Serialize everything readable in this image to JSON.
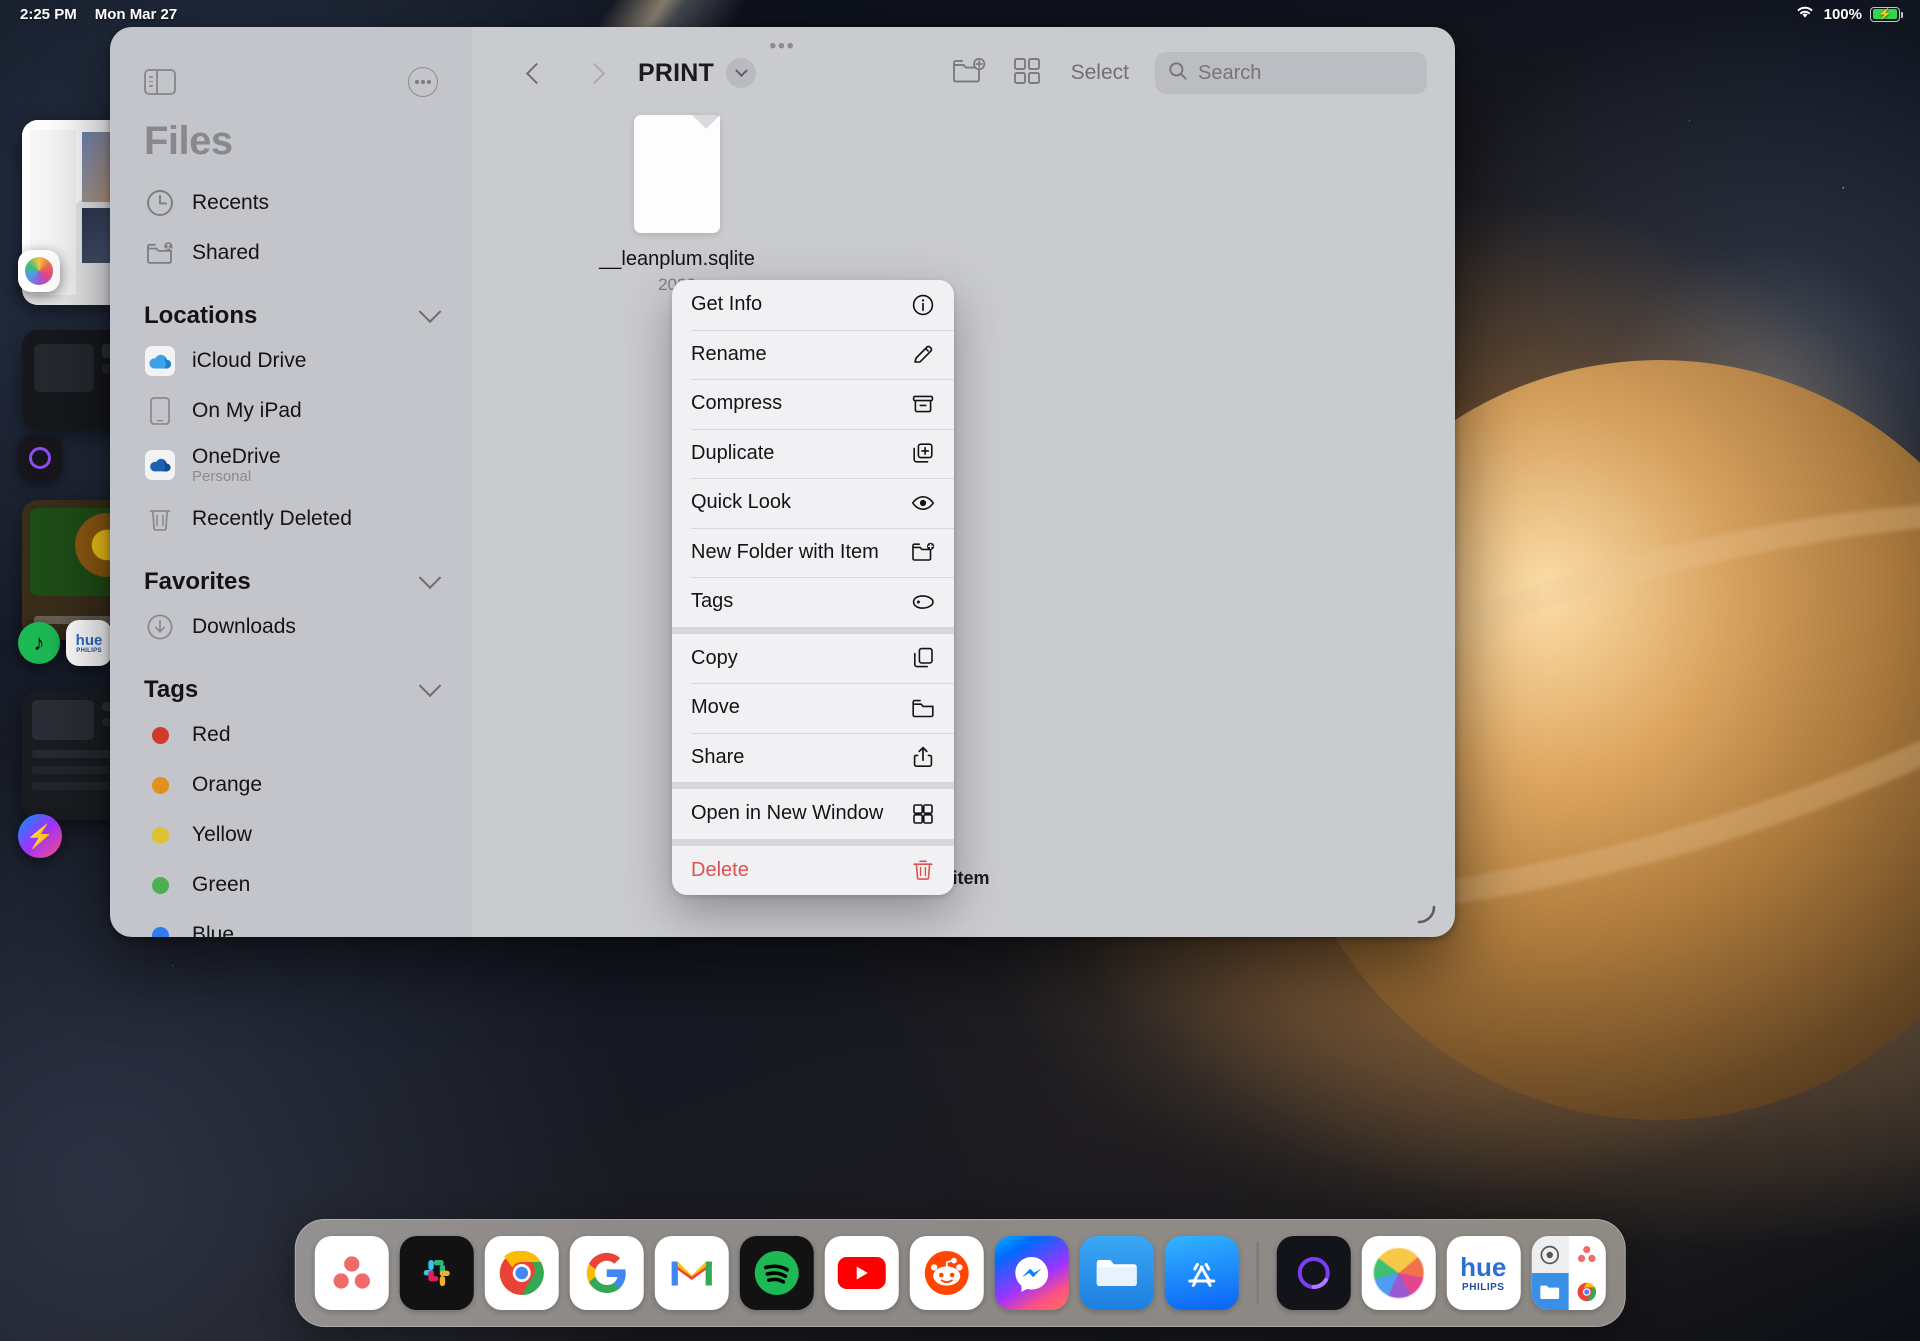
{
  "status_bar": {
    "time": "2:25 PM",
    "date": "Mon Mar 27",
    "wifi_icon": "wifi-icon",
    "battery_percent": "100%",
    "battery_state": "charging",
    "battery_color": "#32d74b"
  },
  "window": {
    "grabber": "•••",
    "sidebar": {
      "toggle_icon": "sidebar-toggle-icon",
      "more_icon": "ellipsis-circle-icon",
      "title": "Files",
      "top_items": [
        {
          "label": "Recents",
          "icon": "clock-icon"
        },
        {
          "label": "Shared",
          "icon": "shared-folder-icon"
        }
      ],
      "sections": [
        {
          "title": "Locations",
          "chevron": "chevron-down-icon",
          "items": [
            {
              "label": "iCloud Drive",
              "icon": "icloud-drive-icon",
              "sublabel": ""
            },
            {
              "label": "On My iPad",
              "icon": "ipad-icon",
              "sublabel": ""
            },
            {
              "label": "OneDrive",
              "icon": "onedrive-icon",
              "sublabel": "Personal"
            },
            {
              "label": "Recently Deleted",
              "icon": "trash-icon",
              "sublabel": ""
            }
          ]
        },
        {
          "title": "Favorites",
          "chevron": "chevron-down-icon",
          "items": [
            {
              "label": "Downloads",
              "icon": "download-circle-icon",
              "sublabel": ""
            }
          ]
        },
        {
          "title": "Tags",
          "chevron": "chevron-down-icon",
          "items": [
            {
              "label": "Red",
              "icon": "tag-dot-icon",
              "color": "#d0392b"
            },
            {
              "label": "Orange",
              "icon": "tag-dot-icon",
              "color": "#e0901f"
            },
            {
              "label": "Yellow",
              "icon": "tag-dot-icon",
              "color": "#ddc233"
            },
            {
              "label": "Green",
              "icon": "tag-dot-icon",
              "color": "#4caf50"
            },
            {
              "label": "Blue",
              "icon": "tag-dot-icon",
              "color": "#2f7dea"
            }
          ]
        }
      ]
    },
    "toolbar": {
      "back_icon": "chevron-left-icon",
      "forward_icon": "chevron-right-icon",
      "folder_title": "PRINT",
      "title_menu_icon": "chevron-down-circle-icon",
      "new_folder_icon": "new-folder-icon",
      "grid_view_icon": "grid-view-icon",
      "select_label": "Select",
      "search_icon": "search-icon",
      "search_placeholder": "Search",
      "search_value": ""
    },
    "files": [
      {
        "name": "__leanplum.sqlite",
        "meta": "2023",
        "icon": "document-icon"
      }
    ],
    "status": "1 item",
    "resize_icon": "resize-handle-icon"
  },
  "context_menu": {
    "groups": [
      [
        {
          "label": "Get Info",
          "icon": "info-circle-icon",
          "danger": false
        },
        {
          "label": "Rename",
          "icon": "pencil-icon",
          "danger": false
        },
        {
          "label": "Compress",
          "icon": "archive-box-icon",
          "danger": false
        },
        {
          "label": "Duplicate",
          "icon": "duplicate-icon",
          "danger": false
        },
        {
          "label": "Quick Look",
          "icon": "eye-icon",
          "danger": false
        },
        {
          "label": "New Folder with Item",
          "icon": "folder-plus-icon",
          "danger": false
        },
        {
          "label": "Tags",
          "icon": "tag-icon",
          "danger": false
        }
      ],
      [
        {
          "label": "Copy",
          "icon": "copy-icon",
          "danger": false
        },
        {
          "label": "Move",
          "icon": "folder-icon",
          "danger": false
        },
        {
          "label": "Share",
          "icon": "share-icon",
          "danger": false
        }
      ],
      [
        {
          "label": "Open in New Window",
          "icon": "new-window-icon",
          "danger": false
        }
      ],
      [
        {
          "label": "Delete",
          "icon": "trash-icon",
          "danger": true
        }
      ]
    ],
    "danger_color": "#d9534f"
  },
  "dock": {
    "apps": [
      {
        "name": "Asana",
        "icon": "asana-icon"
      },
      {
        "name": "Slack",
        "icon": "slack-icon"
      },
      {
        "name": "Chrome",
        "icon": "chrome-icon"
      },
      {
        "name": "Google",
        "icon": "google-icon"
      },
      {
        "name": "Gmail",
        "icon": "gmail-icon"
      },
      {
        "name": "Spotify",
        "icon": "spotify-icon"
      },
      {
        "name": "YouTube",
        "icon": "youtube-icon"
      },
      {
        "name": "Reddit",
        "icon": "reddit-icon"
      },
      {
        "name": "Messenger",
        "icon": "messenger-icon"
      },
      {
        "name": "Files",
        "icon": "files-icon"
      },
      {
        "name": "App Store",
        "icon": "appstore-icon"
      }
    ],
    "recents": [
      {
        "name": "Amazon Alexa",
        "icon": "alexa-icon"
      },
      {
        "name": "Photos",
        "icon": "photos-icon"
      },
      {
        "name": "Hue",
        "icon": "hue-icon",
        "label": "hue",
        "sublabel": "PHILIPS"
      }
    ],
    "app_switcher": {
      "name": "App Switcher",
      "icon": "app-switcher-icon"
    }
  }
}
